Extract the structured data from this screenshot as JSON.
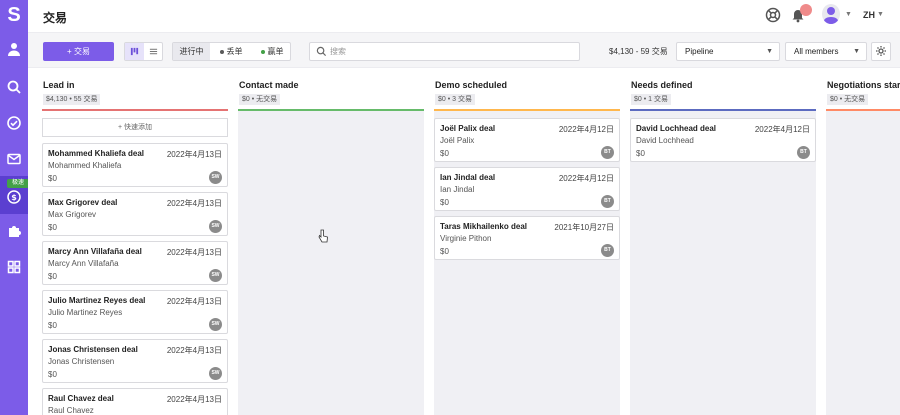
{
  "app": {
    "logo": "S"
  },
  "header": {
    "title": "交易",
    "lang": "ZH"
  },
  "sidebar": {
    "badge": "极速",
    "items": [
      {
        "name": "sidebar-item-contacts",
        "icon": "person-icon"
      },
      {
        "name": "sidebar-item-search",
        "icon": "search-icon"
      },
      {
        "name": "sidebar-item-tasks",
        "icon": "check-circle-icon"
      },
      {
        "name": "sidebar-item-mail",
        "icon": "mail-icon"
      },
      {
        "name": "sidebar-item-deals",
        "icon": "dollar-icon"
      },
      {
        "name": "sidebar-item-integrations",
        "icon": "puzzle-icon"
      },
      {
        "name": "sidebar-item-apps",
        "icon": "grid-icon"
      }
    ]
  },
  "toolbar": {
    "add_label": "+ 交易",
    "status": [
      "进行中",
      "丢单",
      "赢单"
    ],
    "status_colors": [
      "#333333",
      "#5a5a5a",
      "#43a047"
    ],
    "search_placeholder": "搜索",
    "summary": "$4,130 - 59 交易",
    "pipeline": "Pipeline",
    "members": "All members"
  },
  "columns": [
    {
      "name": "Lead in",
      "meta": "$4,130 • 55 交易",
      "color": "#e57373",
      "quick_add": "+ 快速添加",
      "cards": [
        {
          "title": "Mohammed Khaliefa deal",
          "date": "2022年4月13日",
          "person": "Mohammed Khaliefa",
          "value": "$0",
          "owner": "SW"
        },
        {
          "title": "Max Grigorev deal",
          "date": "2022年4月13日",
          "person": "Max Grigorev",
          "value": "$0",
          "owner": "SW"
        },
        {
          "title": "Marcy Ann Villafaña deal",
          "date": "2022年4月13日",
          "person": "Marcy Ann Villafaña",
          "value": "$0",
          "owner": "SW"
        },
        {
          "title": "Julio Martinez Reyes deal",
          "date": "2022年4月13日",
          "person": "Julio Martinez Reyes",
          "value": "$0",
          "owner": "SW"
        },
        {
          "title": "Jonas Christensen deal",
          "date": "2022年4月13日",
          "person": "Jonas Christensen",
          "value": "$0",
          "owner": "SW"
        },
        {
          "title": "Raul Chavez deal",
          "date": "2022年4月13日",
          "person": "Raul Chavez",
          "value": "",
          "owner": ""
        }
      ]
    },
    {
      "name": "Contact made",
      "meta": "$0 • 无交易",
      "color": "#66bb6a",
      "cards": []
    },
    {
      "name": "Demo scheduled",
      "meta": "$0 • 3 交易",
      "color": "#ffb74d",
      "cards": [
        {
          "title": "Joël Palix deal",
          "date": "2022年4月12日",
          "person": "Joël Palix",
          "value": "$0",
          "owner": "BT"
        },
        {
          "title": "Ian Jindal deal",
          "date": "2022年4月12日",
          "person": "Ian Jindal",
          "value": "$0",
          "owner": "BT"
        },
        {
          "title": "Taras Mikhailenko deal",
          "date": "2021年10月27日",
          "person": "Virginie Pithon",
          "value": "$0",
          "owner": "BT"
        }
      ]
    },
    {
      "name": "Needs defined",
      "meta": "$0 • 1 交易",
      "color": "#5c6bc0",
      "cards": [
        {
          "title": "David Lochhead deal",
          "date": "2022年4月12日",
          "person": "David Lochhead",
          "value": "$0",
          "owner": "BT"
        }
      ]
    },
    {
      "name": "Negotiations started",
      "meta": "$0 • 无交易",
      "color": "#ff8a65",
      "cards": []
    }
  ]
}
